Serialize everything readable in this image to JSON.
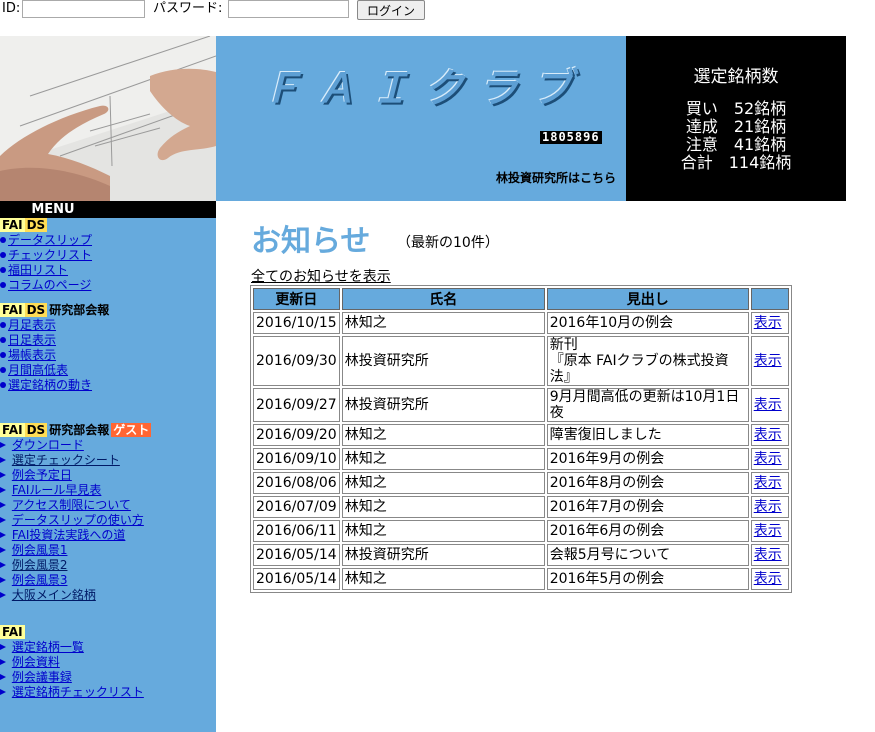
{
  "login": {
    "id_label": "ID:",
    "password_label": "パスワード:",
    "id_value": "",
    "password_value": "",
    "login_button": "ログイン"
  },
  "header": {
    "title": "ＦＡＩクラブ",
    "counter": "1805896",
    "lab_link": "林投資研究所はこちら",
    "stats_title": "選定銘柄数",
    "stats": [
      "買い　52銘柄",
      "達成　21銘柄",
      "注意　41銘柄",
      "合計　114銘柄"
    ]
  },
  "sidebar": {
    "menu_label": "MENU",
    "badges": {
      "fai": "FAI",
      "ds": "DS",
      "guest": "ゲスト"
    },
    "section1": {
      "items": [
        "データスリップ",
        "チェックリスト",
        "福田リスト",
        "コラムのページ"
      ]
    },
    "section2": {
      "title": "研究部会報",
      "items": [
        "月足表示",
        "日足表示",
        "場帳表示",
        "月間高低表",
        "選定銘柄の動き"
      ]
    },
    "section3": {
      "title": "研究部会報",
      "items": [
        "ダウンロード",
        "選定チェックシート",
        "例会予定日",
        "FAIルール早見表",
        "アクセス制限について",
        "データスリップの使い方",
        "FAI投資法実践への道",
        "例会風景1",
        "例会風景2",
        "例会風景3",
        "大阪メイン銘柄"
      ]
    },
    "section4": {
      "items": [
        "選定銘柄一覧",
        "例会資料",
        "例会議事録",
        "選定銘柄チェックリスト"
      ]
    }
  },
  "news": {
    "title": "お知らせ",
    "subtitle": "（最新の10件）",
    "all_link": "全てのお知らせを表示",
    "columns": [
      "更新日",
      "氏名",
      "見出し",
      ""
    ],
    "rows": [
      {
        "date": "2016/10/15",
        "name": "林知之",
        "headline": "2016年10月の例会",
        "link": "表示"
      },
      {
        "date": "2016/09/30",
        "name": "林投資研究所",
        "headline": "新刊\n『原本 FAIクラブの株式投資法』",
        "link": "表示"
      },
      {
        "date": "2016/09/27",
        "name": "林投資研究所",
        "headline": "9月月間高低の更新は10月1日夜",
        "link": "表示"
      },
      {
        "date": "2016/09/20",
        "name": "林知之",
        "headline": "障害復旧しました",
        "link": "表示"
      },
      {
        "date": "2016/09/10",
        "name": "林知之",
        "headline": "2016年9月の例会",
        "link": "表示"
      },
      {
        "date": "2016/08/06",
        "name": "林知之",
        "headline": "2016年8月の例会",
        "link": "表示"
      },
      {
        "date": "2016/07/09",
        "name": "林知之",
        "headline": "2016年7月の例会",
        "link": "表示"
      },
      {
        "date": "2016/06/11",
        "name": "林知之",
        "headline": "2016年6月の例会",
        "link": "表示"
      },
      {
        "date": "2016/05/14",
        "name": "林投資研究所",
        "headline": "会報5月号について",
        "link": "表示"
      },
      {
        "date": "2016/05/14",
        "name": "林知之",
        "headline": "2016年5月の例会",
        "link": "表示"
      }
    ]
  },
  "colors": {
    "accent_blue": "#66aadd",
    "link": "#0000cc",
    "badge_yellow": "#ffff99",
    "badge_ds": "#ffdd55",
    "badge_guest": "#ff6633"
  }
}
